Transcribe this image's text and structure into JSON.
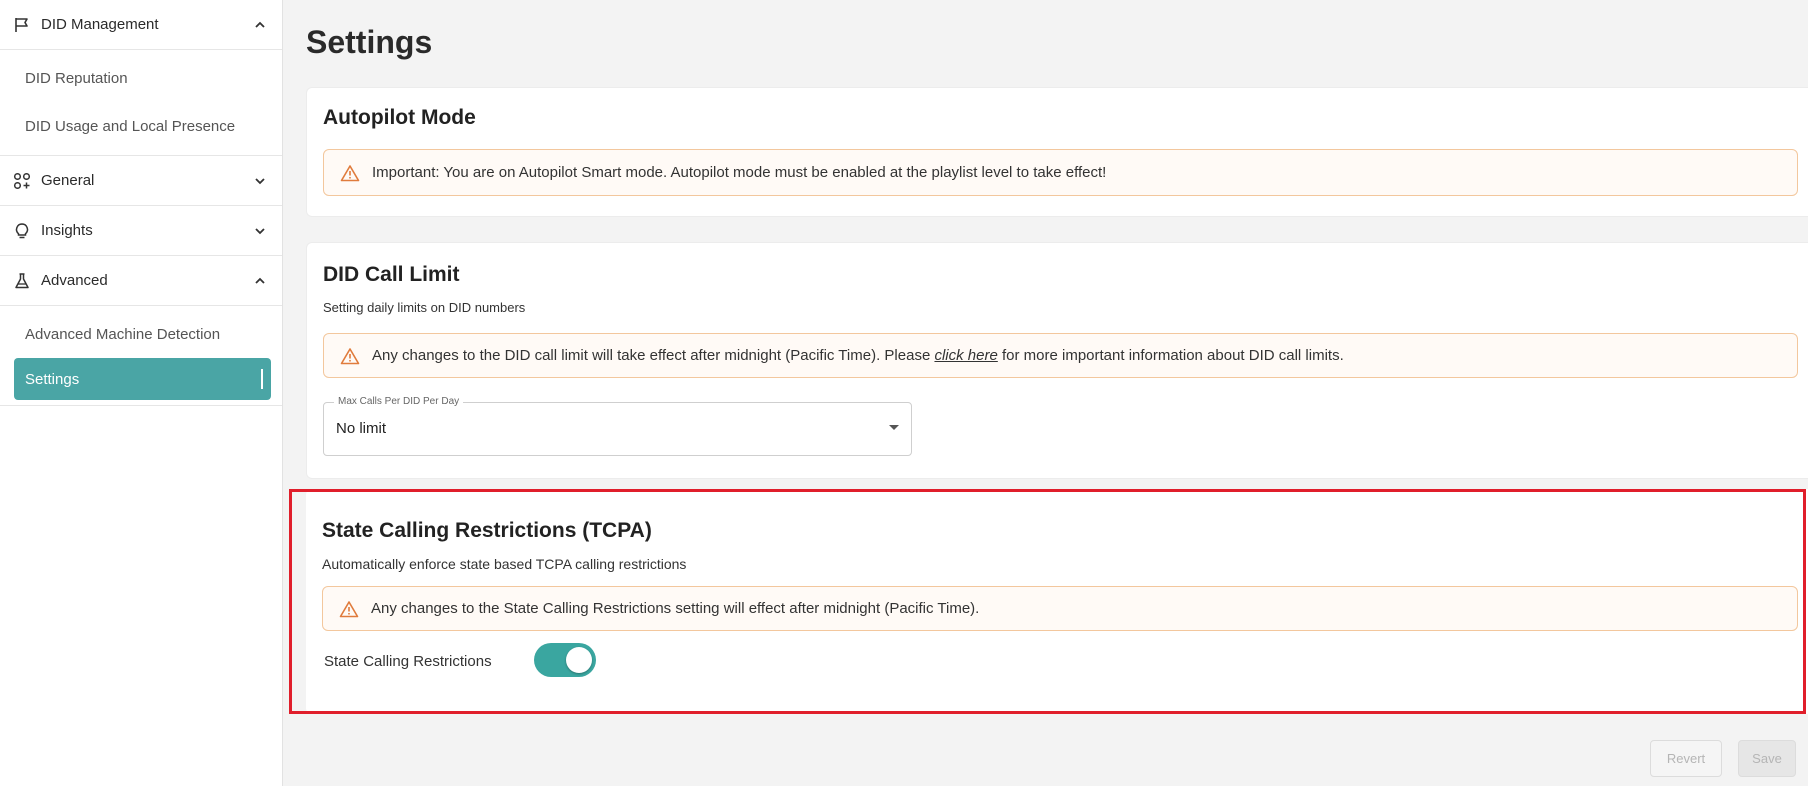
{
  "sidebar": {
    "did_management": {
      "label": "DID Management",
      "expanded": true,
      "items": [
        "DID Reputation",
        "DID Usage and Local Presence"
      ]
    },
    "general": {
      "label": "General",
      "expanded": false
    },
    "insights": {
      "label": "Insights",
      "expanded": false
    },
    "advanced": {
      "label": "Advanced",
      "expanded": true,
      "items": [
        "Advanced Machine Detection",
        "Settings"
      ],
      "active_item": "Settings"
    }
  },
  "page": {
    "title": "Settings"
  },
  "autopilot": {
    "title": "Autopilot Mode",
    "alert": "Important: You are on Autopilot Smart mode. Autopilot mode must be enabled at the playlist level to take effect!"
  },
  "call_limit": {
    "title": "DID Call Limit",
    "subtitle": "Setting daily limits on DID numbers",
    "alert_before": "Any changes to the DID call limit will take effect after midnight (Pacific Time). Please ",
    "alert_link": "click here",
    "alert_after": " for more important information about DID call limits.",
    "select_label": "Max Calls Per DID Per Day",
    "select_value": "No limit"
  },
  "tcpa": {
    "title": "State Calling Restrictions (TCPA)",
    "subtitle": "Automatically enforce state based TCPA calling restrictions",
    "alert": "Any changes to the State Calling Restrictions setting will effect after midnight (Pacific Time).",
    "toggle_label": "State Calling Restrictions",
    "toggle_on": true
  },
  "footer": {
    "revert_label": "Revert",
    "save_label": "Save"
  },
  "colors": {
    "accent": "#4aa5a5",
    "toggle": "#3aa6a0",
    "warning": "#e07b3c",
    "highlight": "#e01e2b"
  }
}
